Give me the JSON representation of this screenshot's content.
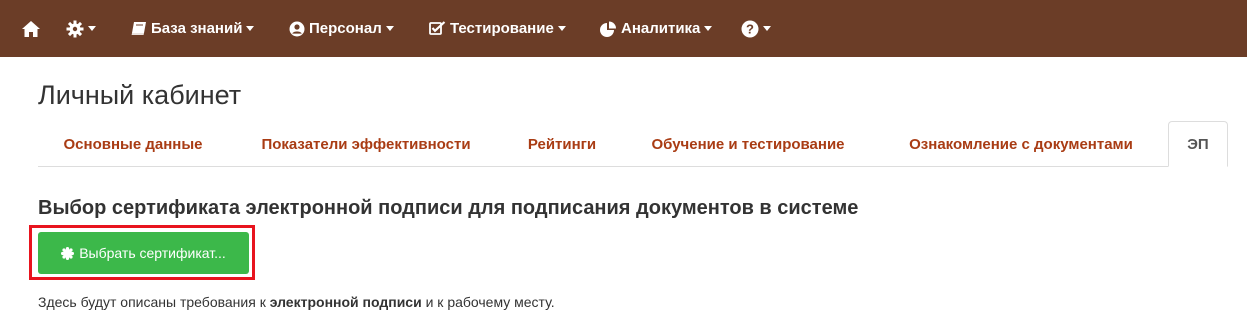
{
  "navbar": {
    "home_icon": "home-icon",
    "settings_icon": "gear-icon",
    "items": [
      {
        "icon": "book-icon",
        "label": "База знаний"
      },
      {
        "icon": "user-circle-icon",
        "label": "Персонал"
      },
      {
        "icon": "checkbox-edit-icon",
        "label": "Тестирование"
      },
      {
        "icon": "pie-chart-icon",
        "label": "Аналитика"
      }
    ],
    "help_icon": "question-circle-icon",
    "bg_color": "#6b3d27"
  },
  "page": {
    "title": "Личный кабинет"
  },
  "tabs": [
    {
      "label": "Основные данные",
      "active": false
    },
    {
      "label": "Показатели эффективности",
      "active": false
    },
    {
      "label": "Рейтинги",
      "active": false
    },
    {
      "label": "Обучение и тестирование",
      "active": false
    },
    {
      "label": "Ознакомление с документами",
      "active": false
    },
    {
      "label": "ЭП",
      "active": true
    }
  ],
  "content": {
    "heading": "Выбор сертификата электронной подписи для подписания документов в системе",
    "button_label": "Выбрать сертификат...",
    "button_icon": "certificate-icon",
    "description_before": "Здесь будут описаны требования к ",
    "description_bold": "электронной подписи",
    "description_after": " и к рабочему месту."
  },
  "colors": {
    "accent": "#a93c14",
    "button": "#3cb84a",
    "highlight": "#e8141e"
  }
}
